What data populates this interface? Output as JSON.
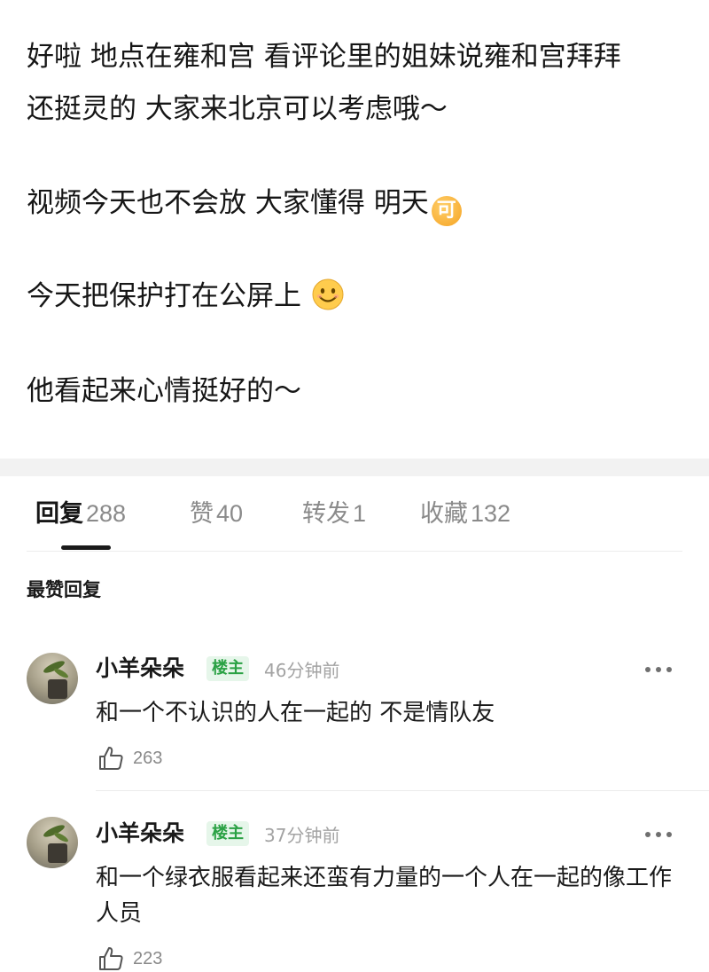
{
  "post": {
    "line1": "好啦 地点在雍和宫 看评论里的姐妹说雍和宫拜拜",
    "line2": "还挺灵的 大家来北京可以考虑哦～",
    "line3": "视频今天也不会放 大家懂得 明天",
    "line3_emoji": "可",
    "line4": "今天把保护打在公屏上",
    "line5": "他看起来心情挺好的～"
  },
  "tabs": [
    {
      "label": "回复",
      "count": "288"
    },
    {
      "label": "赞",
      "count": "40"
    },
    {
      "label": "转发",
      "count": "1"
    },
    {
      "label": "收藏",
      "count": "132"
    }
  ],
  "section_title": "最赞回复",
  "comments": [
    {
      "name": "小羊朵朵",
      "badge": "楼主",
      "time": "46分钟前",
      "text": "和一个不认识的人在一起的 不是情队友",
      "likes": "263"
    },
    {
      "name": "小羊朵朵",
      "badge": "楼主",
      "time": "37分钟前",
      "text": "和一个绿衣服看起来还蛮有力量的一个人在一起的像工作人员",
      "likes": "223"
    }
  ],
  "icons": {
    "like": "thumbs-up-icon",
    "more": "more-dots-icon",
    "smile": "smile-emoji-icon"
  }
}
